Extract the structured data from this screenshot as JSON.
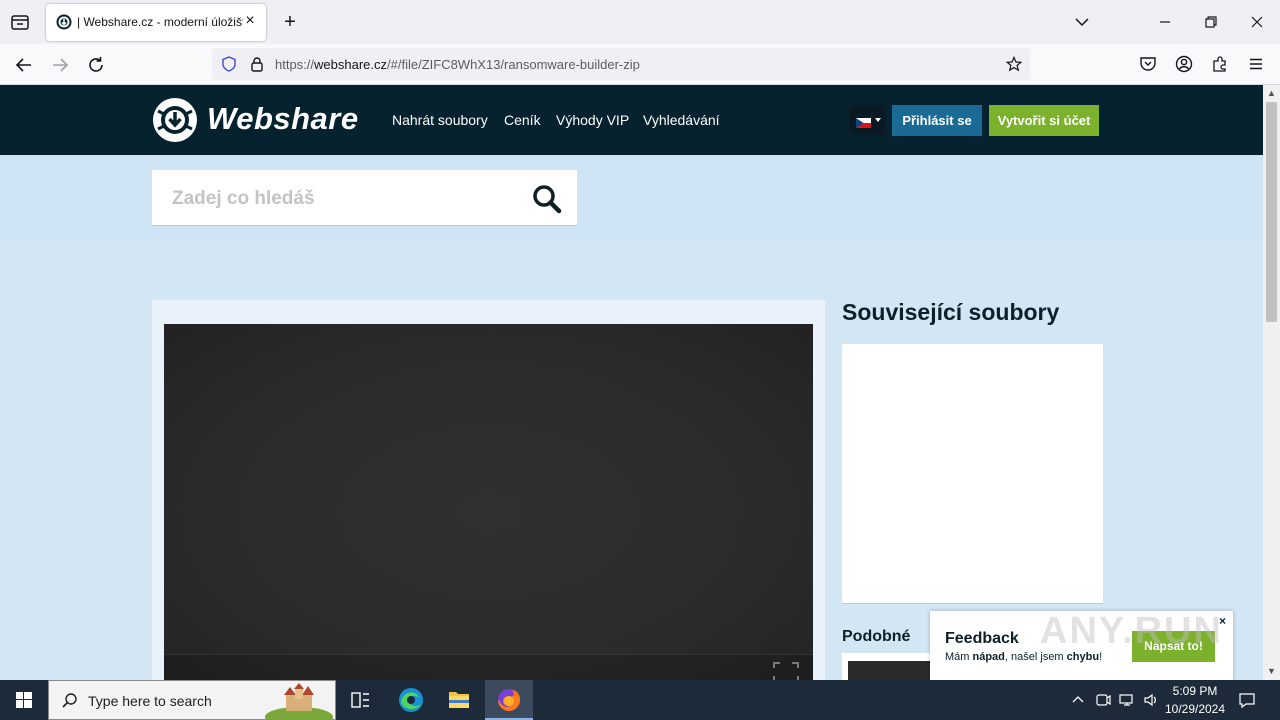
{
  "browser": {
    "tab_title": "| Webshare.cz - moderní úložiště",
    "url_prefix": "https://",
    "url_host": "webshare.cz",
    "url_path": "/#/file/ZIFC8WhX13/ransomware-builder-zip"
  },
  "site": {
    "logo_text": "Webshare",
    "menu": [
      "Nahrát soubory",
      "Ceník",
      "Výhody VIP",
      "Vyhledávání"
    ],
    "login_label": "Přihlásit se",
    "signup_label": "Vytvořit si účet",
    "search_placeholder": "Zadej co hledáš",
    "related_title": "Související soubory",
    "similar_title": "Podobné",
    "feedback": {
      "title": "Feedback",
      "text_before": "Mám ",
      "text_bold1": "nápad",
      "text_middle": ", našel jsem ",
      "text_bold2": "chybu",
      "text_end": "!",
      "button": "Napsat to!",
      "close": "×"
    },
    "watermark": "ANY.RUN",
    "accent_colors": {
      "header": "#06222e",
      "login": "#1a6a96",
      "signup": "#7cb22b",
      "page_bg": "#d3e6f4"
    }
  },
  "taskbar": {
    "search_placeholder": "Type here to search",
    "time": "5:09 PM",
    "date": "10/29/2024"
  }
}
